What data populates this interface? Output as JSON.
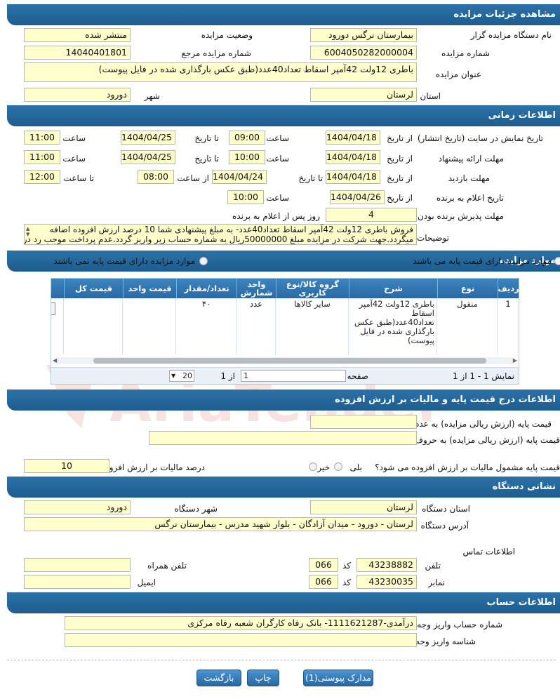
{
  "sections": {
    "details": "مشاهده جزئیات مزایده",
    "timing": "اطلاعات زمانی",
    "items": "موارد مزایده",
    "pricing": "اطلاعات درج قیمت پایه و مالیات بر ارزش افزوده",
    "address": "نشانی دستگاه",
    "account": "اطلاعات حساب"
  },
  "details": {
    "org_name_label": "نام دستگاه مزایده گزار",
    "org_name": "بیمارستان نرگس دورود",
    "status_label": "وضعیت مزایده",
    "status": "منتشر شده",
    "number_label": "شماره مزایده",
    "number": "6004050282000004",
    "ref_label": "شماره مزایده مرجع",
    "ref": "14040401801",
    "title_label": "عنوان مزایده",
    "title": "باطری 12ولت 42آمپر اسقاط تعداد40عدد(طبق عکس بارگذاری شده در فایل پیوست)",
    "province_label": "استان",
    "province": "لرستان",
    "city_label": "شهر",
    "city": "دورود"
  },
  "timing": {
    "display_from_label": "تاریخ نمایش در سایت (تاریخ انتشار)",
    "from_label": "از تاریخ",
    "to_label": "تا تاریخ",
    "time_label": "ساعت",
    "from_hour_label": "از ساعت",
    "to_hour_label": "تا ساعت",
    "display_from": "1404/04/18",
    "display_from_time": "09:00",
    "display_to": "1404/04/25",
    "display_to_time": "11:00",
    "offer_label": "مهلت ارائه پیشنهاد",
    "offer_from": "1404/04/18",
    "offer_from_time": "10:00",
    "offer_to": "1404/04/25",
    "offer_to_time": "11:00",
    "visit_label": "مهلت بازدید",
    "visit_from": "1404/04/18",
    "visit_to": "1404/04/24",
    "visit_from_hour": "08:00",
    "visit_to_hour": "12:00",
    "winner_label": "تاریخ اعلام به برنده",
    "winner_date": "1404/04/26",
    "winner_time": "10:00",
    "accept_label": "مهلت پذیرش برنده بودن",
    "accept_days": "4",
    "accept_suffix": "روز پس از اعلام به برنده",
    "desc_label": "توضیحات",
    "desc_line1": "فروش باطری 12ولت 42آمپر اسقاط تعداد40عدد- به مبلغ پیشنهادی شما 10 درصد ارزش افزوده اضافه",
    "desc_line2": "میگردد.جهت شرکت در مزایده مبلغ 50000000ریال به شماره حساب زیر واریز گردد.عدم پرداخت موجب رد در"
  },
  "items": {
    "with_base": "موارد مزایده دارای قیمت پایه می باشند",
    "without_base": "موارد مزایده دارای قیمت پایه نمی باشند",
    "headers": [
      "ردیف",
      "نوع",
      "شرح",
      "گروه کالا/نوع کاربری",
      "واحد شمارش",
      "تعداد/مقدار",
      "قیمت واحد",
      "قیمت کل"
    ],
    "row": {
      "index": "1",
      "type": "منقول",
      "desc": "باطری 12ولت 42آمپر اسقاط تعداد40عدد(طبق عکس بارگذاری شده در فایل پیوست)",
      "group": "سایر کالاها",
      "unit": "عدد",
      "qty": "۴۰",
      "unit_price": "",
      "total_price": ""
    },
    "pager": {
      "summary": "نمایش 1 - 1 از 1",
      "page_label": "صفحه",
      "page_value": "1",
      "of_label": "از 1",
      "page_size": "20"
    }
  },
  "pricing": {
    "base_num_label": "قیمت پایه (ارزش ریالی مزایده) به عدد",
    "base_num": "",
    "base_text_label": "قیمت پایه (ارزش ریالی مزایده) به حروف",
    "base_text": "",
    "vat_question": "قیمت پایه مشمول مالیات بر ارزش افزوده می شود؟",
    "yes": "بلی",
    "no": "خیر",
    "vat_percent_label": "درصد مالیات بر ارزش افزوده",
    "vat_percent": "10"
  },
  "address": {
    "province_label": "استان دستگاه",
    "province": "لرستان",
    "city_label": "شهر دستگاه",
    "city": "دورود",
    "address_label": "آدرس دستگاه",
    "address": "لرستان - دورود - میدان آزادگان - بلوار شهید مدرس - بیمارستان نرگس",
    "contact_label": "اطلاعات تماس",
    "phone_label": "تلفن",
    "phone": "43238882",
    "code_label": "کد",
    "phone_code": "066",
    "mobile_label": "تلفن همراه",
    "mobile": "",
    "fax_label": "نمابر",
    "fax": "43230035",
    "fax_code": "066",
    "email_label": "ایمیل",
    "email": ""
  },
  "account": {
    "number_label": "شماره حساب واریز وجه",
    "number": "درآمدی-1111621287- بانک رفاه کارگران شعبه رفاه مرکزی",
    "id_label": "شناسه واریز وجه",
    "id": ""
  },
  "buttons": {
    "attachments": "مدارک پیوستی(1)",
    "print": "چاپ",
    "back": "بازگشت"
  },
  "watermark": "AriaTender.net",
  "colors": {
    "header": "#2b72a8",
    "field": "#ffffcc",
    "button": "#3a82c2"
  }
}
